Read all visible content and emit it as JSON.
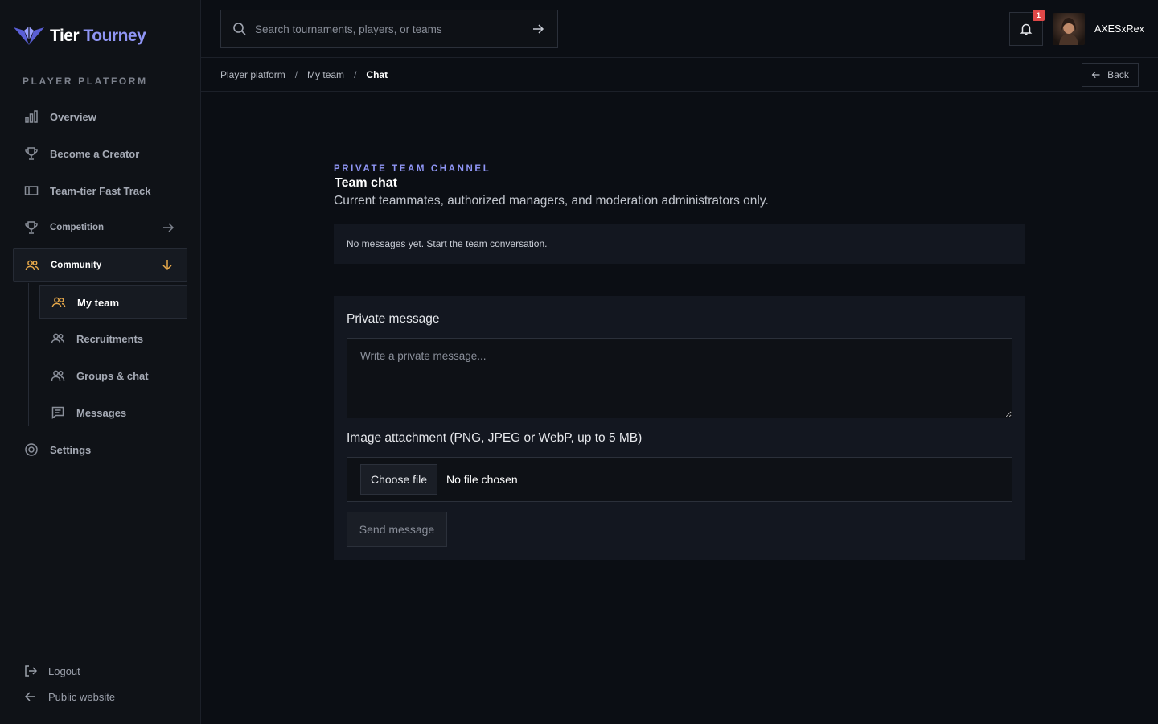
{
  "brand": {
    "name_part1": "Tier",
    "name_part2": "Tourney"
  },
  "sidebar": {
    "section_title": "PLAYER PLATFORM",
    "items": [
      {
        "label": "Overview",
        "icon": "bar-chart-icon"
      },
      {
        "label": "Become a Creator",
        "icon": "trophy-icon"
      },
      {
        "label": "Team-tier Fast Track",
        "icon": "ticket-icon"
      },
      {
        "label": "Competition",
        "icon": "trophy-icon"
      },
      {
        "label": "Community",
        "icon": "users-icon"
      }
    ],
    "community_sub": [
      {
        "label": "My team",
        "icon": "users-icon"
      },
      {
        "label": "Recruitments",
        "icon": "users-icon"
      },
      {
        "label": "Groups & chat",
        "icon": "users-icon"
      },
      {
        "label": "Messages",
        "icon": "message-icon"
      }
    ],
    "settings": {
      "label": "Settings",
      "icon": "gear-icon"
    },
    "footer": {
      "logout": "Logout",
      "public_website": "Public website"
    }
  },
  "topbar": {
    "search_placeholder": "Search tournaments, players, or teams",
    "notification_count": "1",
    "username": "AXESxRex"
  },
  "breadcrumb": {
    "items": [
      "Player platform",
      "My team",
      "Chat"
    ],
    "separator": "/",
    "back_label": "Back"
  },
  "main": {
    "eyebrow": "PRIVATE TEAM CHANNEL",
    "title": "Team chat",
    "description": "Current teammates, authorized managers, and moderation administrators only.",
    "empty_state": "No messages yet. Start the team conversation.",
    "composer": {
      "message_label": "Private message",
      "message_placeholder": "Write a private message...",
      "attachment_label": "Image attachment (PNG, JPEG or WebP, up to 5 MB)",
      "choose_file": "Choose file",
      "no_file": "No file chosen",
      "send_label": "Send message"
    }
  },
  "colors": {
    "accent": "#8f95f5",
    "active": "#e8a94a",
    "badge": "#e04848",
    "background": "#0b0e14"
  }
}
